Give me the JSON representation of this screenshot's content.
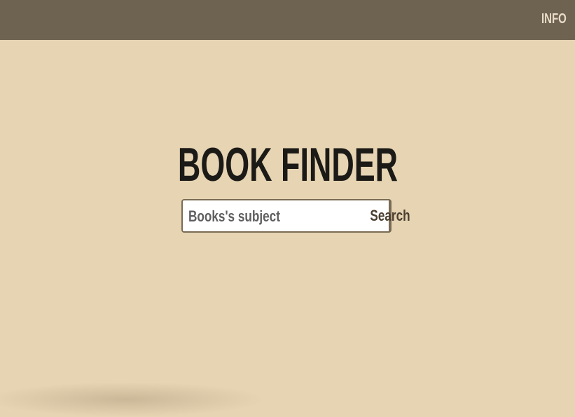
{
  "header": {
    "info_label": "INFO"
  },
  "main": {
    "title": "BOOK FINDER"
  },
  "search": {
    "placeholder": "Books's subject",
    "value": "",
    "button_label": "Search"
  },
  "colors": {
    "header_bg": "#6e6250",
    "page_bg": "#e6d4b3",
    "border": "#7a6b55"
  }
}
